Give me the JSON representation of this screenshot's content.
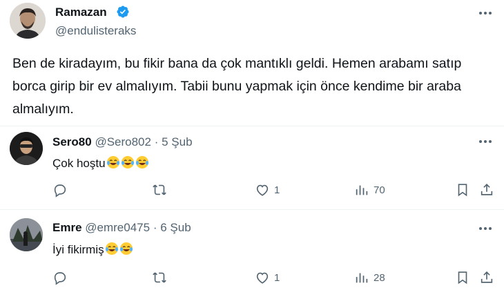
{
  "main_tweet": {
    "author_name": "Ramazan",
    "author_handle": "@endulisteraks",
    "verified": true,
    "text": "Ben de kiradayım, bu fikir bana da çok mantıklı geldi. Hemen arabamı satıp borca girip bir ev almalıyım. Tabii bunu yapmak için önce kendime bir araba almalıyım."
  },
  "replies": [
    {
      "display_name": "Sero80",
      "handle": "@Sero802",
      "separator": "·",
      "date": "5 Şub",
      "text": "Çok hoştu",
      "emojis": [
        "laughing-tears",
        "laughing-tears",
        "laughing-tears"
      ],
      "likes": "1",
      "views": "70"
    },
    {
      "display_name": "Emre",
      "handle": "@emre0475",
      "separator": "·",
      "date": "6 Şub",
      "text": "İyi fikirmiş",
      "emojis": [
        "laughing-tears",
        "laughing-tears"
      ],
      "likes": "1",
      "views": "28"
    }
  ],
  "colors": {
    "text_primary": "#0f1419",
    "text_secondary": "#536471",
    "verified_blue": "#1d9bf0",
    "divider": "#eff3f4"
  },
  "icons": [
    "more-icon",
    "verified-badge-icon",
    "reply-icon",
    "retweet-icon",
    "like-icon",
    "views-icon",
    "bookmark-icon",
    "share-icon"
  ]
}
